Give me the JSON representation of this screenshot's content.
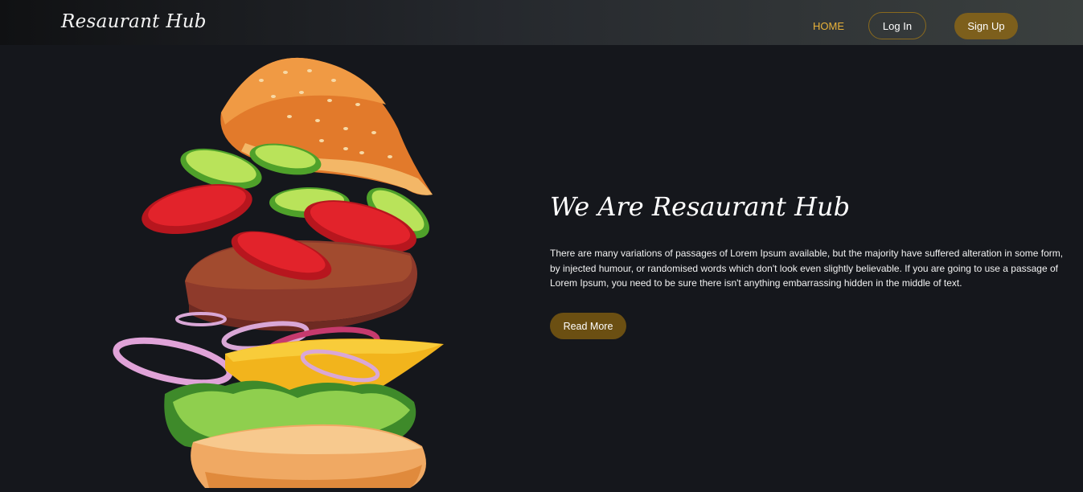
{
  "nav": {
    "brand": "Resaurant Hub",
    "home": "HOME",
    "login": "Log In",
    "signup": "Sign Up"
  },
  "hero": {
    "title": "We Are Resaurant Hub",
    "text": "There are many variations of passages of Lorem Ipsum available, but the majority have suffered alteration in some form, by injected humour, or randomised words which don't look even slightly believable. If you are going to use a passage of Lorem Ipsum, you need to be sure there isn't anything embarrassing hidden in the middle of text.",
    "button": "Read More",
    "image_icon": "burger-illustration"
  },
  "colors": {
    "accent": "#e8b23a",
    "gold_button": "#7d5f1c",
    "read_button": "#6b4f12",
    "background": "#15171c"
  }
}
